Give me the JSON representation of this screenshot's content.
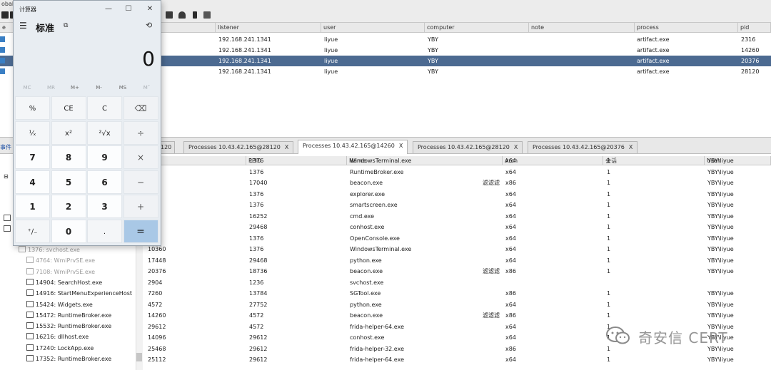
{
  "app": {
    "title_fragment": "obalt"
  },
  "beacons": {
    "columns": [
      "listener",
      "user",
      "computer",
      "note",
      "process",
      "pid"
    ],
    "rows": [
      {
        "listener": "192.168.241.1341",
        "user": "liyue",
        "computer": "YBY",
        "note": "",
        "process": "artifact.exe",
        "pid": "2316",
        "selected": false
      },
      {
        "listener": "192.168.241.1341",
        "user": "liyue",
        "computer": "YBY",
        "note": "",
        "process": "artifact.exe",
        "pid": "14260",
        "selected": false
      },
      {
        "listener": "192.168.241.1341",
        "user": "liyue",
        "computer": "YBY",
        "note": "",
        "process": "artifact.exe",
        "pid": "20376",
        "selected": true
      },
      {
        "listener": "192.168.241.1341",
        "user": "liyue",
        "computer": "YBY",
        "note": "",
        "process": "artifact.exe",
        "pid": "28120",
        "selected": false
      }
    ]
  },
  "tabs": [
    {
      "label": "120",
      "active": false
    },
    {
      "label": "Processes 10.43.42.165@28120",
      "active": false
    },
    {
      "label": "Processes 10.43.42.165@14260",
      "active": true
    },
    {
      "label": "Processes 10.43.42.165@28120",
      "active": false
    },
    {
      "label": "Processes 10.43.42.165@20376",
      "active": false
    }
  ],
  "tab_close_glyph": "X",
  "left_tab_label": "事件",
  "tree": [
    {
      "label": "1376: svchost.exe",
      "dim": true
    },
    {
      "label": "4764: WmiPrvSE.exe",
      "dim": true
    },
    {
      "label": "7108: WmiPrvSE.exe",
      "dim": true
    },
    {
      "label": "14904: SearchHost.exe",
      "dim": false
    },
    {
      "label": "14916: StartMenuExperienceHost",
      "dim": false
    },
    {
      "label": "15424: Widgets.exe",
      "dim": false
    },
    {
      "label": "15472: RuntimeBroker.exe",
      "dim": false
    },
    {
      "label": "15532: RuntimeBroker.exe",
      "dim": false
    },
    {
      "label": "16216: dllhost.exe",
      "dim": false
    },
    {
      "label": "17240: LockApp.exe",
      "dim": false
    },
    {
      "label": "17352: RuntimeBroker.exe",
      "dim": false
    }
  ],
  "processes": {
    "columns": [
      "PPID",
      "Name",
      "Arch",
      "会话",
      "User"
    ],
    "rows": [
      {
        "pid": "",
        "ppid": "1376",
        "name": "WindowsTerminal.exe",
        "tag": "",
        "arch": "x64",
        "session": "1",
        "user": "YBY\\liyue"
      },
      {
        "pid": "5",
        "ppid": "1376",
        "name": "RuntimeBroker.exe",
        "tag": "",
        "arch": "x64",
        "session": "1",
        "user": "YBY\\liyue"
      },
      {
        "pid": "20",
        "ppid": "17040",
        "name": "beacon.exe",
        "tag": "滤滤滤",
        "arch": "x86",
        "session": "1",
        "user": "YBY\\liyue"
      },
      {
        "pid": "32",
        "ppid": "1376",
        "name": "explorer.exe",
        "tag": "",
        "arch": "x64",
        "session": "1",
        "user": "YBY\\liyue"
      },
      {
        "pid": "52",
        "ppid": "1376",
        "name": "smartscreen.exe",
        "tag": "",
        "arch": "x64",
        "session": "1",
        "user": "YBY\\liyue"
      },
      {
        "pid": "58",
        "ppid": "16252",
        "name": "cmd.exe",
        "tag": "",
        "arch": "x64",
        "session": "1",
        "user": "YBY\\liyue"
      },
      {
        "pid": "92",
        "ppid": "29468",
        "name": "conhost.exe",
        "tag": "",
        "arch": "x64",
        "session": "1",
        "user": "YBY\\liyue"
      },
      {
        "pid": "3",
        "ppid": "1376",
        "name": "OpenConsole.exe",
        "tag": "",
        "arch": "x64",
        "session": "1",
        "user": "YBY\\liyue"
      },
      {
        "pid": "10360",
        "ppid": "1376",
        "name": "WindowsTerminal.exe",
        "tag": "",
        "arch": "x64",
        "session": "1",
        "user": "YBY\\liyue"
      },
      {
        "pid": "17448",
        "ppid": "29468",
        "name": "python.exe",
        "tag": "",
        "arch": "x64",
        "session": "1",
        "user": "YBY\\liyue"
      },
      {
        "pid": "20376",
        "ppid": "18736",
        "name": "beacon.exe",
        "tag": "滤滤滤",
        "arch": "x86",
        "session": "1",
        "user": "YBY\\liyue"
      },
      {
        "pid": "2904",
        "ppid": "1236",
        "name": "svchost.exe",
        "tag": "",
        "arch": "",
        "session": "",
        "user": ""
      },
      {
        "pid": "7260",
        "ppid": "13784",
        "name": "SGTool.exe",
        "tag": "",
        "arch": "x86",
        "session": "1",
        "user": "YBY\\liyue"
      },
      {
        "pid": "4572",
        "ppid": "27752",
        "name": "python.exe",
        "tag": "",
        "arch": "x64",
        "session": "1",
        "user": "YBY\\liyue"
      },
      {
        "pid": "14260",
        "ppid": "4572",
        "name": "beacon.exe",
        "tag": "滤滤滤",
        "arch": "x86",
        "session": "1",
        "user": "YBY\\liyue"
      },
      {
        "pid": "29612",
        "ppid": "4572",
        "name": "frida-helper-64.exe",
        "tag": "",
        "arch": "x64",
        "session": "1",
        "user": "YBY\\liyue"
      },
      {
        "pid": "14096",
        "ppid": "29612",
        "name": "conhost.exe",
        "tag": "",
        "arch": "x64",
        "session": "1",
        "user": "YBY\\liyue"
      },
      {
        "pid": "25468",
        "ppid": "29612",
        "name": "frida-helper-32.exe",
        "tag": "",
        "arch": "x86",
        "session": "1",
        "user": "YBY\\liyue"
      },
      {
        "pid": "25112",
        "ppid": "29612",
        "name": "frida-helper-64.exe",
        "tag": "",
        "arch": "x64",
        "session": "1",
        "user": "YBY\\liyue"
      }
    ]
  },
  "calculator": {
    "title": "计算器",
    "mode": "标准",
    "display": "0",
    "memory": [
      {
        "label": "MC",
        "enabled": false
      },
      {
        "label": "MR",
        "enabled": false
      },
      {
        "label": "M+",
        "enabled": true
      },
      {
        "label": "M-",
        "enabled": true
      },
      {
        "label": "MS",
        "enabled": true
      },
      {
        "label": "M˅",
        "enabled": false
      }
    ],
    "keys": [
      [
        "%",
        "CE",
        "C",
        "⌫"
      ],
      [
        "¹⁄ₓ",
        "x²",
        "²√x",
        "÷"
      ],
      [
        "7",
        "8",
        "9",
        "×"
      ],
      [
        "4",
        "5",
        "6",
        "−"
      ],
      [
        "1",
        "2",
        "3",
        "+"
      ],
      [
        "⁺∕₋",
        "0",
        ".",
        "="
      ]
    ],
    "window_buttons": {
      "minimize": "—",
      "maximize": "☐",
      "close": "✕"
    },
    "icons": {
      "hamburger": "☰",
      "keep_on_top": "⧉",
      "history": "⟲"
    }
  },
  "watermark": {
    "text": "奇安信 CERT"
  }
}
